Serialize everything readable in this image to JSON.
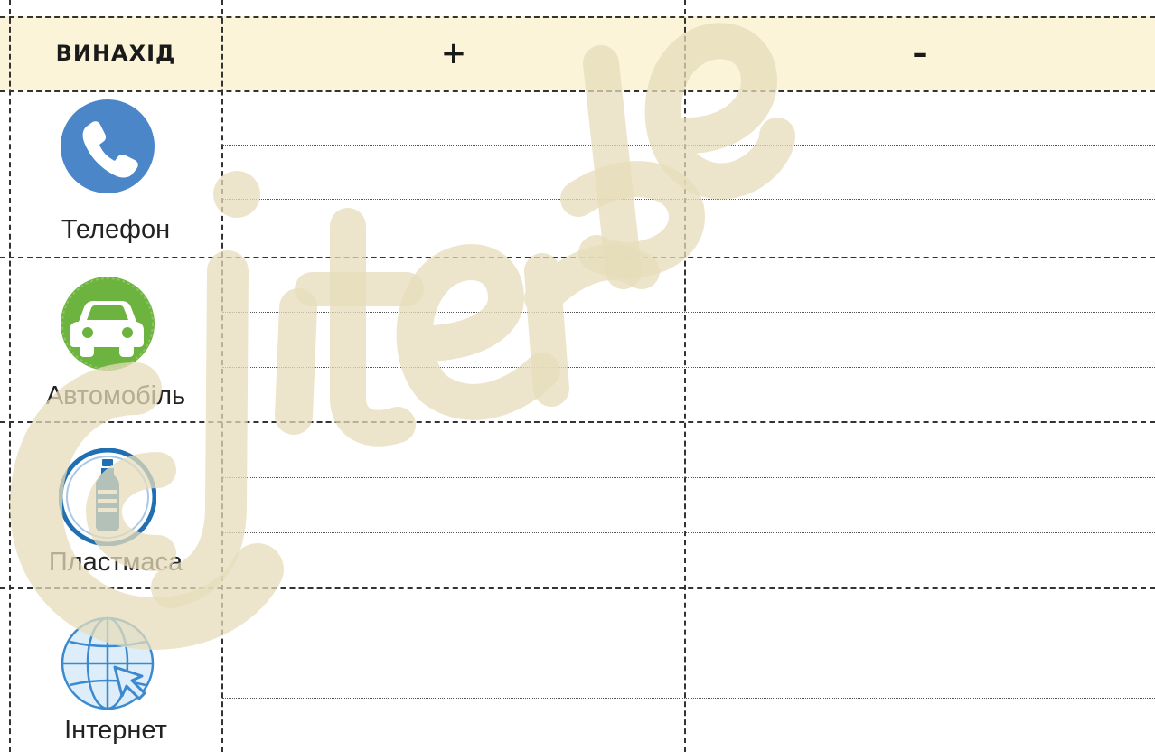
{
  "header": {
    "invention": "ВИНАХІД",
    "plus": "+",
    "minus": "–"
  },
  "items": [
    {
      "label": "Телефон",
      "icon": "phone-icon",
      "color": "#4a86c8"
    },
    {
      "label": "Автомобіль",
      "icon": "car-icon",
      "color": "#6db33f"
    },
    {
      "label": "Пластмаса",
      "icon": "bottle-icon",
      "color": "#1f6fb2"
    },
    {
      "label": "Інтернет",
      "icon": "globe-cursor-icon",
      "color": "#3b8ad0"
    }
  ],
  "colors": {
    "header_bg": "#fbf4d8",
    "watermark": "#e8dfc0"
  }
}
